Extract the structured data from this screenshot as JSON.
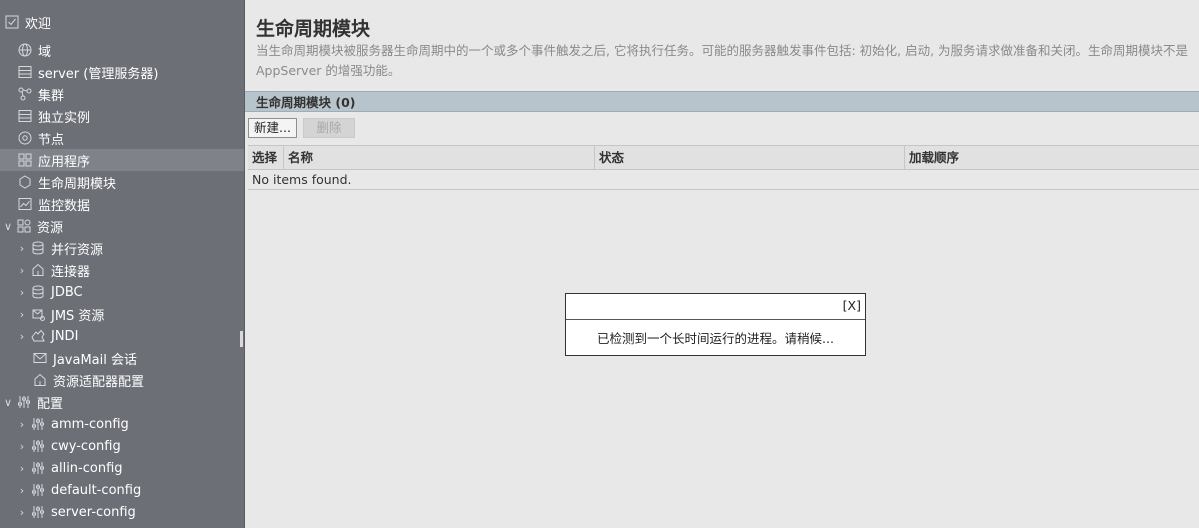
{
  "sidebar": {
    "items": [
      {
        "label": "欢迎",
        "icon": "checkbox-icon",
        "arrow": ""
      },
      {
        "label": "域",
        "icon": "globe-icon",
        "arrow": ""
      },
      {
        "label": "server (管理服务器)",
        "icon": "server-icon",
        "arrow": ""
      },
      {
        "label": "集群",
        "icon": "cluster-icon",
        "arrow": ""
      },
      {
        "label": "独立实例",
        "icon": "server-icon",
        "arrow": ""
      },
      {
        "label": "节点",
        "icon": "node-icon",
        "arrow": ""
      },
      {
        "label": "应用程序",
        "icon": "applications-icon",
        "arrow": ""
      },
      {
        "label": "生命周期模块",
        "icon": "lifecycle-icon",
        "arrow": ""
      },
      {
        "label": "监控数据",
        "icon": "monitoring-icon",
        "arrow": ""
      },
      {
        "label": "资源",
        "icon": "resources-icon",
        "arrow": "∨"
      },
      {
        "label": "并行资源",
        "icon": "database-icon",
        "arrow": "›"
      },
      {
        "label": "连接器",
        "icon": "connector-icon",
        "arrow": "›"
      },
      {
        "label": "JDBC",
        "icon": "database-icon",
        "arrow": "›"
      },
      {
        "label": "JMS 资源",
        "icon": "jms-icon",
        "arrow": "›"
      },
      {
        "label": "JNDI",
        "icon": "jndi-icon",
        "arrow": "›"
      },
      {
        "label": "JavaMail 会话",
        "icon": "mail-icon",
        "arrow": ""
      },
      {
        "label": "资源适配器配置",
        "icon": "connector-icon",
        "arrow": ""
      },
      {
        "label": "配置",
        "icon": "config-icon",
        "arrow": "∨"
      },
      {
        "label": "amm-config",
        "icon": "config-icon",
        "arrow": "›"
      },
      {
        "label": "cwy-config",
        "icon": "config-icon",
        "arrow": "›"
      },
      {
        "label": "allin-config",
        "icon": "config-icon",
        "arrow": "›"
      },
      {
        "label": "default-config",
        "icon": "config-icon",
        "arrow": "›"
      },
      {
        "label": "server-config",
        "icon": "config-icon",
        "arrow": "›"
      }
    ],
    "selected_index": 6
  },
  "main": {
    "title": "生命周期模块",
    "description": "当生命周期模块被服务器生命周期中的一个或多个事件触发之后, 它将执行任务。可能的服务器触发事件包括: 初始化, 启动, 为服务请求做准备和关闭。生命周期模块不是",
    "description_line2": "AppServer 的增强功能。",
    "table": {
      "caption": "生命周期模块 (0)",
      "new_button": "新建...",
      "delete_button": "删除",
      "columns": [
        "选择",
        "名称",
        "状态",
        "加载顺序"
      ],
      "empty_text": "No items found."
    }
  },
  "dialog": {
    "close_label": "[X]",
    "message": "已检测到一个长时间运行的进程。请稍候..."
  }
}
